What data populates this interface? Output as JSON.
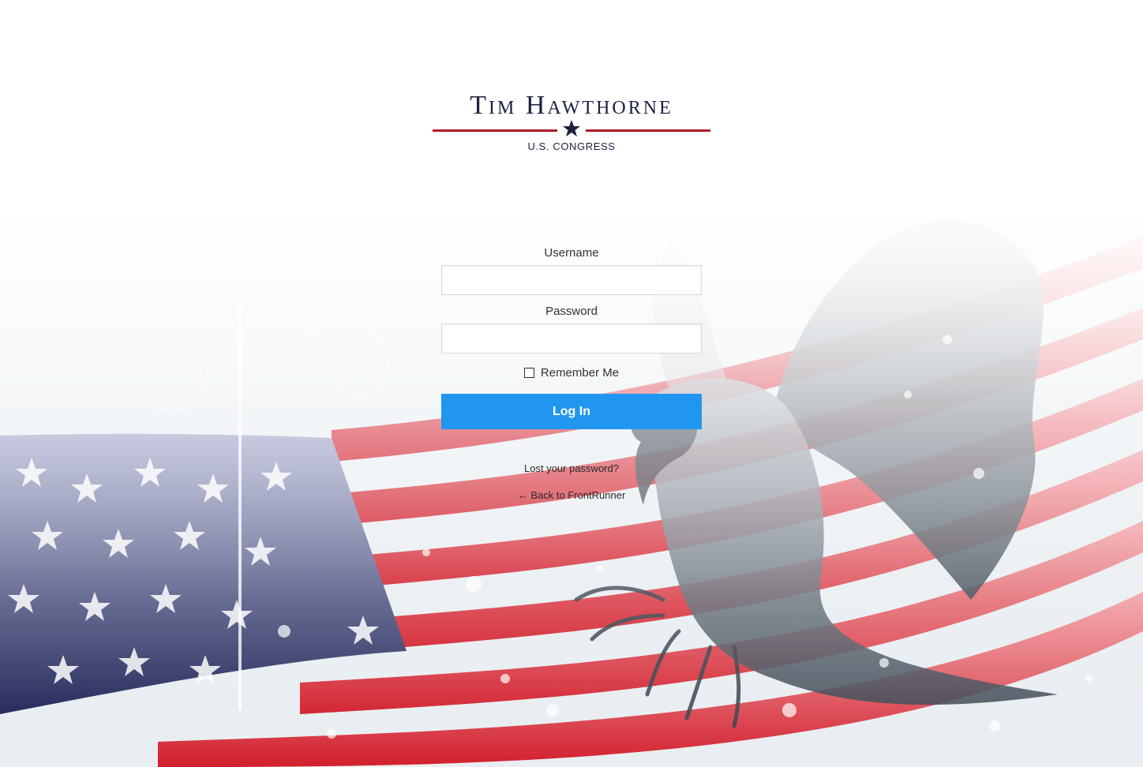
{
  "logo": {
    "name": "Tim Hawthorne",
    "subtitle": "U.S. CONGRESS",
    "icon": "star-icon",
    "colors": {
      "navy": "#1c2140",
      "red": "#b11c2b"
    }
  },
  "login_form": {
    "username_label": "Username",
    "username_value": "",
    "password_label": "Password",
    "password_value": "",
    "remember_label": "Remember Me",
    "remember_checked": false,
    "submit_label": "Log In"
  },
  "links": {
    "lost_password": "Lost your password?",
    "back_arrow": "←",
    "back_to_site": "Back to FrontRunner"
  },
  "colors": {
    "primary_button": "#2196f0",
    "flag_red": "#d8232f",
    "flag_blue": "#2a2f6a"
  },
  "background": {
    "icons": [
      "american-flag-graphic",
      "bald-eagle-graphic"
    ]
  }
}
